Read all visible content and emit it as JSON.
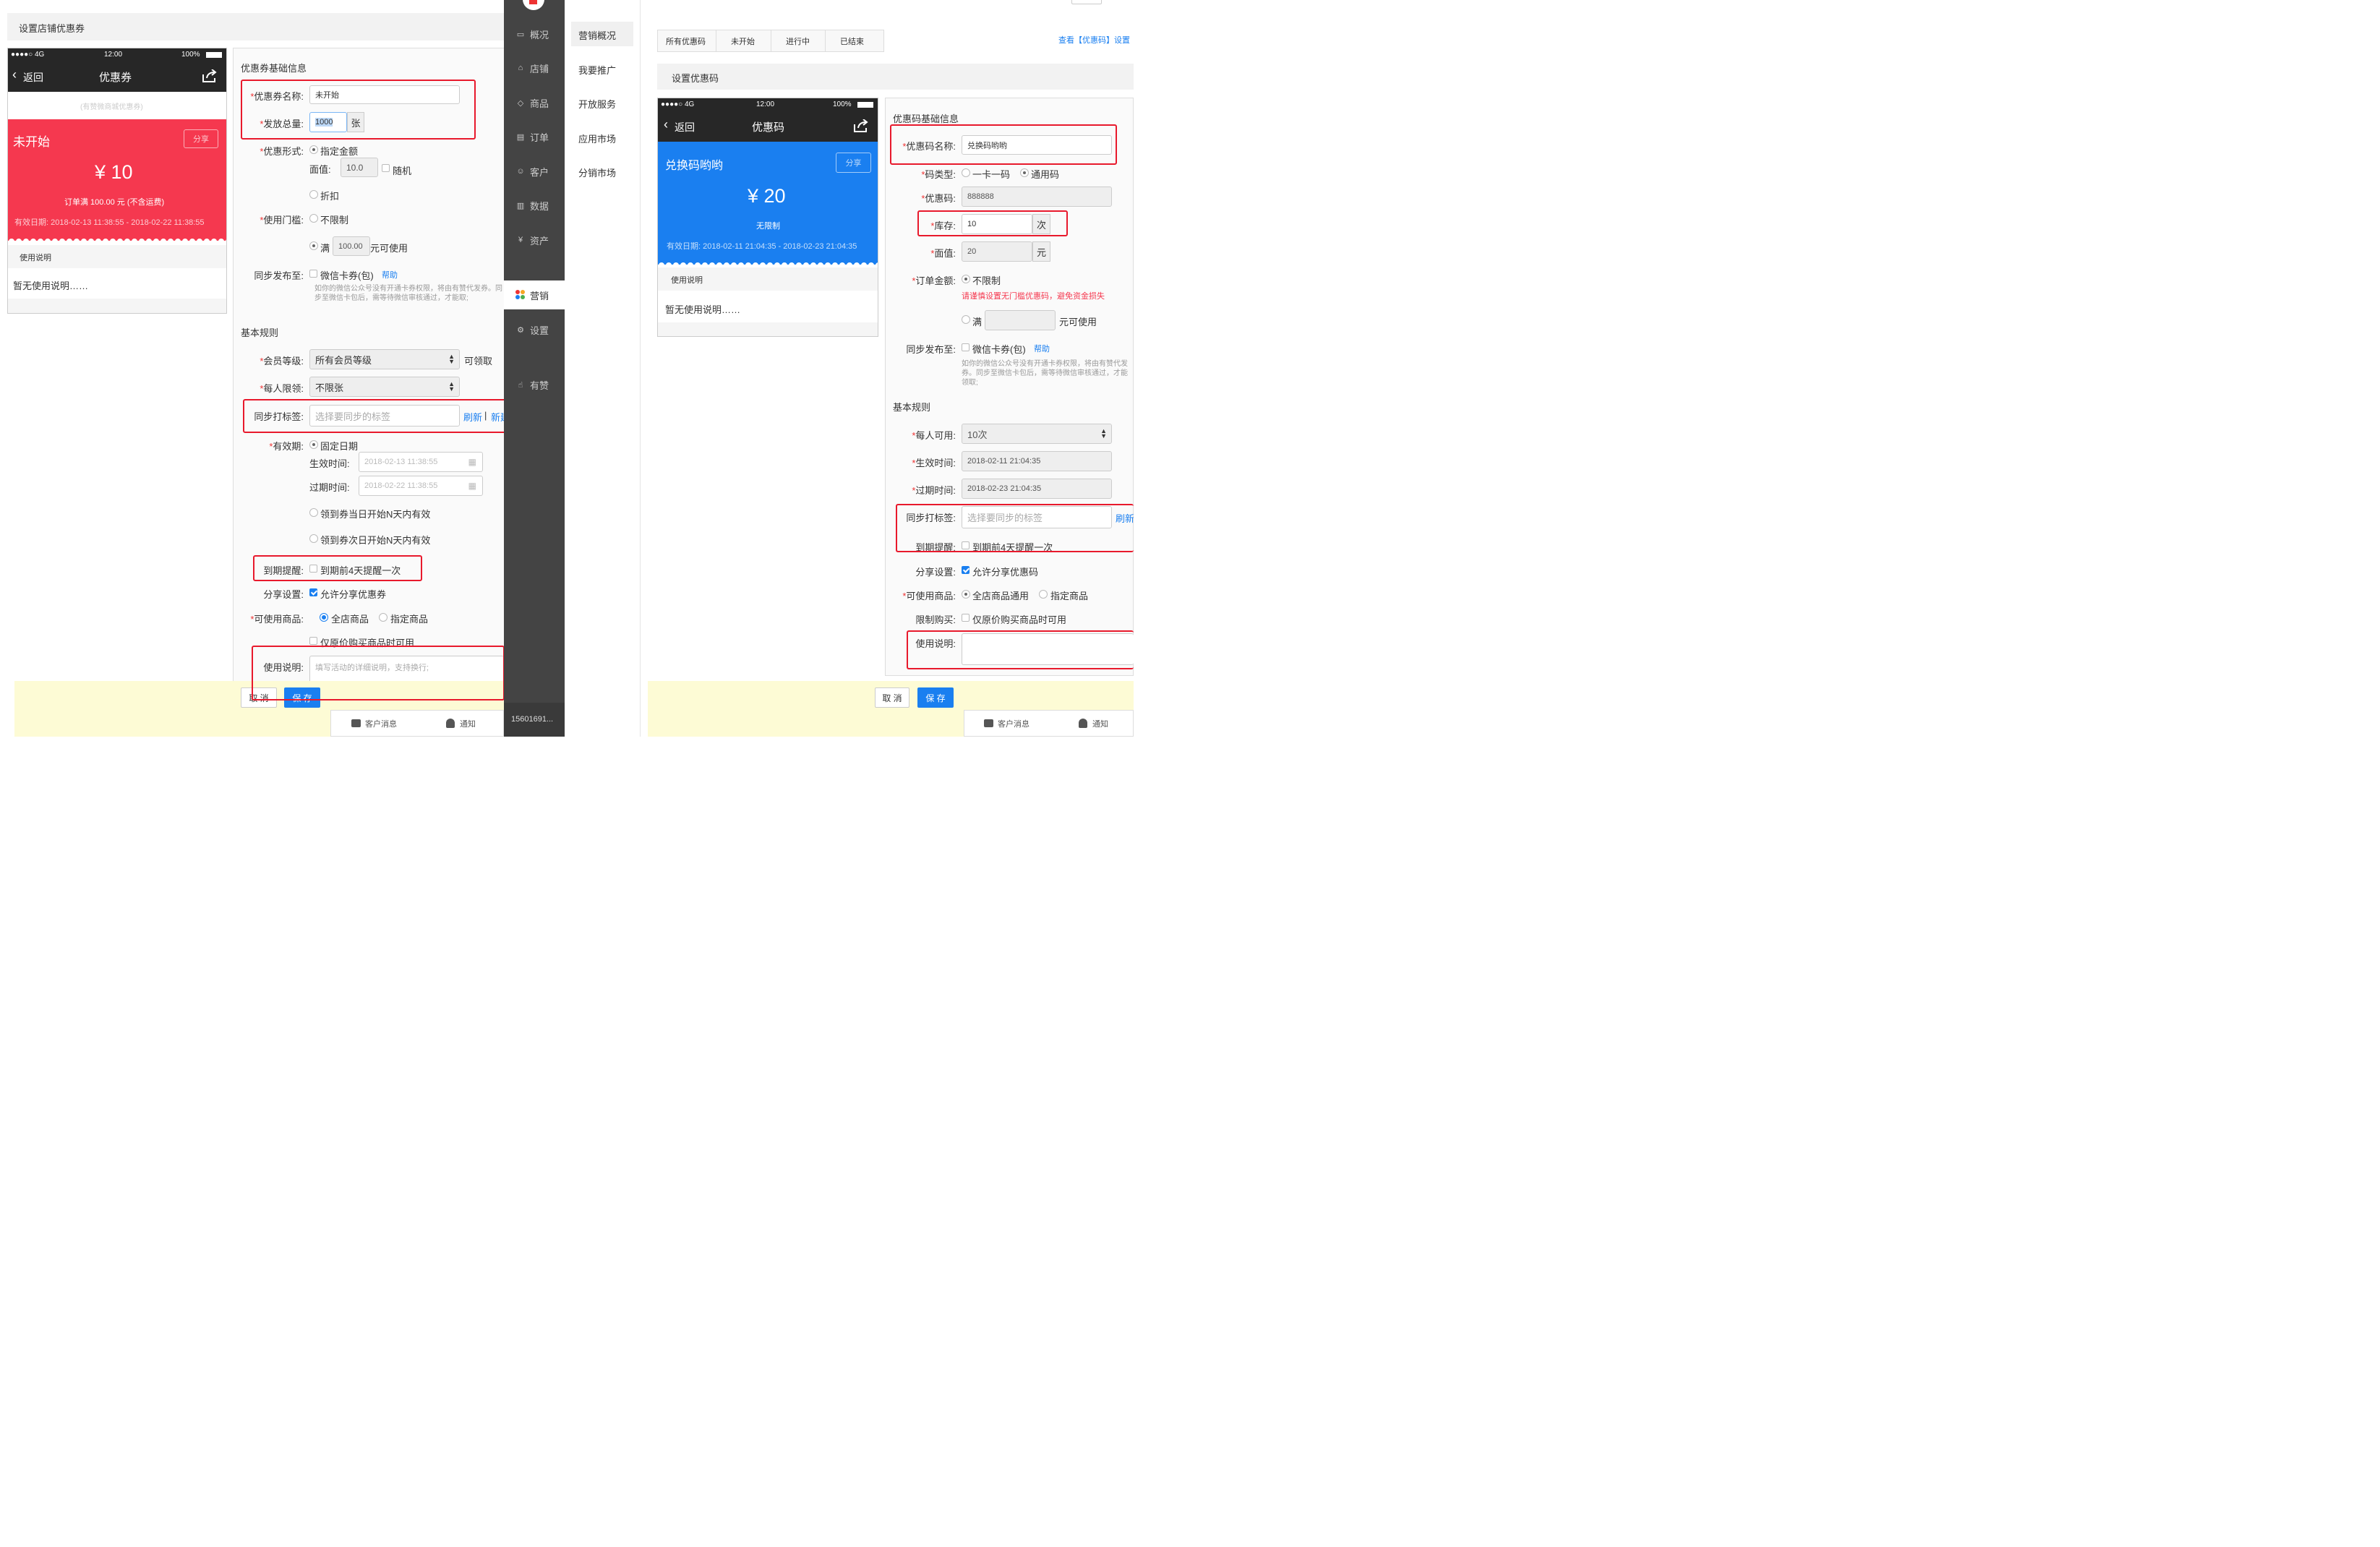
{
  "left": {
    "page_title": "设置店铺优惠券",
    "phone": {
      "signal": "●●●●○ 4G",
      "time": "12:00",
      "battery": "100%",
      "back": "返回",
      "title": "优惠券",
      "subtitle": "(有赞微商城优惠券)",
      "status": "未开始",
      "share": "分享",
      "amount": "¥ 10",
      "condition": "订单满 100.00 元 (不含运费)",
      "validity": "有效日期:  2018-02-13 11:38:55 - 2018-02-22 11:38:55",
      "usage_title": "使用说明",
      "usage_text": "暂无使用说明……"
    },
    "form": {
      "section_basic": "优惠券基础信息",
      "name_label": "优惠券名称:",
      "name_value": "未开始",
      "total_label": "发放总量:",
      "total_value": "1000",
      "total_unit": "张",
      "form_label": "优惠形式:",
      "fixed_amount": "指定金额",
      "face_label": "面值:",
      "face_value": "10.0",
      "random": "随机",
      "discount": "折扣",
      "threshold_label": "使用门槛:",
      "no_limit": "不限制",
      "full": "满",
      "full_value": "100.00",
      "full_suffix": "元可使用",
      "sync_label": "同步发布至:",
      "wechat_card": "微信卡券(包)",
      "help": "帮助",
      "sync_note": "如你的微信公众号没有开通卡券权限，将由有赞代发券。同步至微信卡包后，需等待微信审核通过，才能取;",
      "section_rules": "基本规则",
      "member_label": "会员等级:",
      "member_value": "所有会员等级",
      "member_suffix": "可领取",
      "limit_label": "每人限领:",
      "limit_value": "不限张",
      "tag_label": "同步打标签:",
      "tag_placeholder": "选择要同步的标签",
      "refresh": "刷新",
      "sep": "|",
      "new": "新建",
      "valid_label": "有效期:",
      "fixed_date": "固定日期",
      "start_label": "生效时间:",
      "start_value": "2018-02-13 11:38:55",
      "end_label": "过期时间:",
      "end_value": "2018-02-22 11:38:55",
      "opt_same_day": "领到券当日开始N天内有效",
      "opt_next_day": "领到券次日开始N天内有效",
      "remind_label": "到期提醒:",
      "remind_text": "到期前4天提醒一次",
      "share_label": "分享设置:",
      "share_text": "允许分享优惠券",
      "goods_label": "可使用商品:",
      "goods_all": "全店商品",
      "goods_specific": "指定商品",
      "original_price": "仅原价购买商品时可用",
      "usage_label": "使用说明:",
      "usage_placeholder": "填写活动的详细说明，支持换行;",
      "cancel": "取 消",
      "save": "保 存"
    },
    "bottom": {
      "messages": "客户消息",
      "notify": "通知"
    }
  },
  "sidebar": {
    "items": [
      {
        "icon": "overview-icon",
        "label": "概况"
      },
      {
        "icon": "store-icon",
        "label": "店铺"
      },
      {
        "icon": "goods-icon",
        "label": "商品"
      },
      {
        "icon": "order-icon",
        "label": "订单"
      },
      {
        "icon": "customer-icon",
        "label": "客户"
      },
      {
        "icon": "data-icon",
        "label": "数据"
      },
      {
        "icon": "asset-icon",
        "label": "资产"
      },
      {
        "icon": "marketing-icon",
        "label": "营销"
      },
      {
        "icon": "settings-icon",
        "label": "设置"
      },
      {
        "icon": "youzan-icon",
        "label": "有赞"
      }
    ],
    "account": "15601691..."
  },
  "subnav": {
    "items": [
      "营销概况",
      "我要推广",
      "开放服务",
      "应用市场",
      "分销市场"
    ]
  },
  "right": {
    "tabs": [
      "所有优惠码",
      "未开始",
      "进行中",
      "已结束"
    ],
    "top_link": "查看【优惠码】设置",
    "page_title": "设置优惠码",
    "phone": {
      "signal": "●●●●○ 4G",
      "time": "12:00",
      "battery": "100%",
      "back": "返回",
      "title": "优惠码",
      "name": "兑换码哟哟",
      "share": "分享",
      "amount": "¥ 20",
      "condition": "无限制",
      "validity": "有效日期:  2018-02-11 21:04:35 - 2018-02-23 21:04:35",
      "usage_title": "使用说明",
      "usage_text": "暂无使用说明……"
    },
    "form": {
      "section_basic": "优惠码基础信息",
      "name_label": "优惠码名称:",
      "name_value": "兑换码哟哟",
      "type_label": "码类型:",
      "type_one": "一卡一码",
      "type_common": "通用码",
      "code_label": "优惠码:",
      "code_value": "888888",
      "stock_label": "库存:",
      "stock_value": "10",
      "stock_unit": "次",
      "face_label": "面值:",
      "face_value": "20",
      "face_unit": "元",
      "order_label": "订单金额:",
      "no_limit": "不限制",
      "warning": "请谨慎设置无门槛优惠码，避免资金损失",
      "full": "满",
      "full_suffix": "元可使用",
      "sync_label": "同步发布至:",
      "wechat_card": "微信卡券(包)",
      "help": "帮助",
      "sync_note": "如你的微信公众号没有开通卡券权限，将由有赞代发券。同步至微信卡包后，需等待微信审核通过，才能领取;",
      "section_rules": "基本规则",
      "per_label": "每人可用:",
      "per_value": "10次",
      "start_label": "生效时间:",
      "start_value": "2018-02-11 21:04:35",
      "end_label": "过期时间:",
      "end_value": "2018-02-23 21:04:35",
      "tag_label": "同步打标签:",
      "tag_placeholder": "选择要同步的标签",
      "refresh": "刷新",
      "remind_label": "到期提醒:",
      "remind_text": "到期前4天提醒一次",
      "share_label": "分享设置:",
      "share_text": "允许分享优惠码",
      "goods_label": "可使用商品:",
      "goods_all": "全店商品通用",
      "goods_specific": "指定商品",
      "limit_label": "限制购买:",
      "limit_text": "仅原价购买商品时可用",
      "usage_label": "使用说明:",
      "cancel": "取 消",
      "save": "保 存"
    },
    "bottom": {
      "messages": "客户消息",
      "notify": "通知"
    }
  },
  "colors": {
    "coupon_red": "#f5384f",
    "code_blue": "#1a7ff0",
    "sidebar": "#444444",
    "highlight": "#e8192c"
  }
}
